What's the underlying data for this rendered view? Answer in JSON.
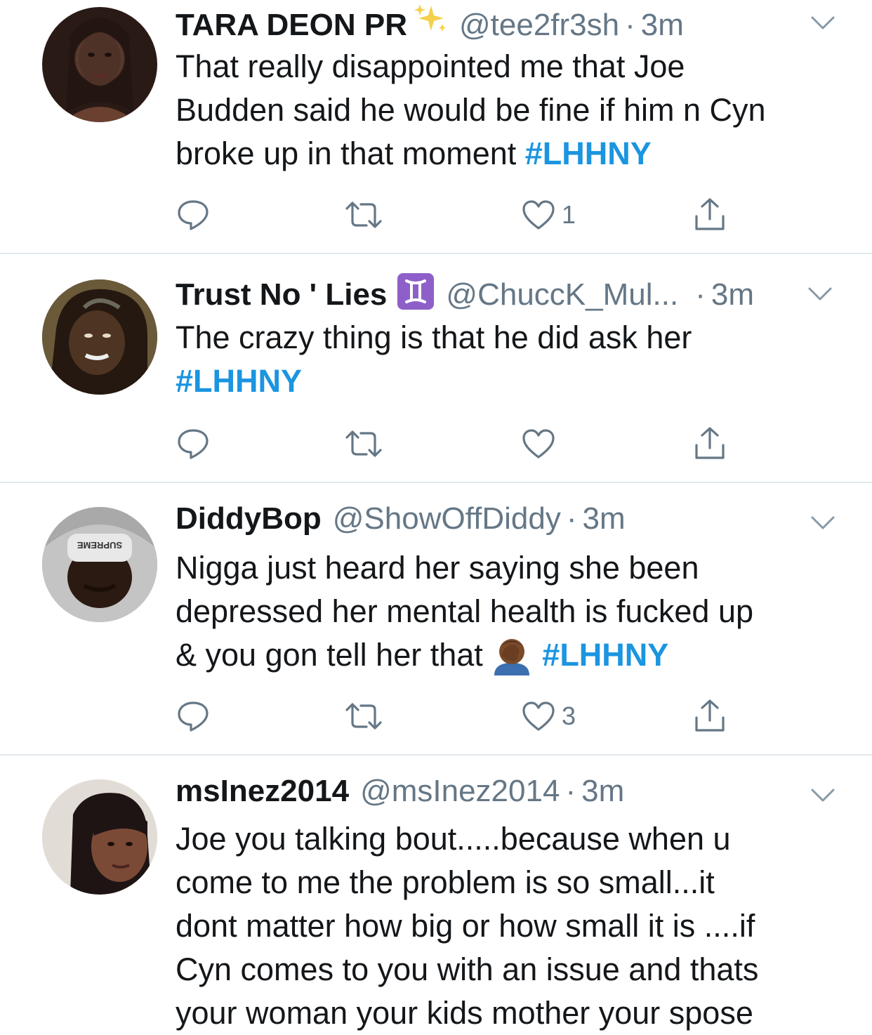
{
  "tweets": [
    {
      "name": "TARA DEON PR",
      "badge_icon": "sparkles-icon",
      "handle": "@tee2fr3sh",
      "dot": "·",
      "time": "3m",
      "text_lines": [
        "That really disappointed me that Joe",
        "Budden said he would be fine if him n Cyn",
        "broke up in that moment "
      ],
      "hashtag": "#LHHNY",
      "text_tail": "",
      "reply_count": "",
      "retweet_count": "",
      "like_count": "1",
      "avatar_color": "#3a2520"
    },
    {
      "name": "Trust No ' Lies",
      "badge_icon": "gemini-icon",
      "handle": "@ChuccK_Mul...",
      "dot": "·",
      "time": "3m",
      "text_lines": [
        "The crazy thing is that he did ask her"
      ],
      "hashtag": "#LHHNY",
      "text_tail": "",
      "reply_count": "",
      "retweet_count": "",
      "like_count": "",
      "avatar_color": "#4a3a28"
    },
    {
      "name": "DiddyBop",
      "badge_icon": "",
      "handle": "@ShowOffDiddy",
      "dot": "·",
      "time": "3m",
      "text_lines": [
        "Nigga just heard her saying she been",
        "depressed her mental health is fucked up",
        "& you gon tell her that "
      ],
      "hashtag": "#LHHNY",
      "emoji_icon": "face-palm-icon",
      "text_tail": "",
      "reply_count": "",
      "retweet_count": "",
      "like_count": "3",
      "avatar_color": "#8a8a8a",
      "avatar_hat_text": "SUPREME"
    },
    {
      "name": "msInez2014",
      "badge_icon": "",
      "handle": "@msInez2014",
      "dot": "·",
      "time": "3m",
      "text_lines": [
        "Joe you talking bout.....because when u",
        "come to me the problem is so small...it",
        "dont matter how big or how small it is ....if",
        "Cyn comes to you with an issue and thats",
        "your woman your kids mother your spose"
      ],
      "hashtag": "",
      "text_tail": "",
      "avatar_color": "#2b2020"
    }
  ],
  "colors": {
    "name": "#14171a",
    "meta": "#657786",
    "hashtag": "#1b95e0",
    "divider": "#e1e8ed"
  }
}
